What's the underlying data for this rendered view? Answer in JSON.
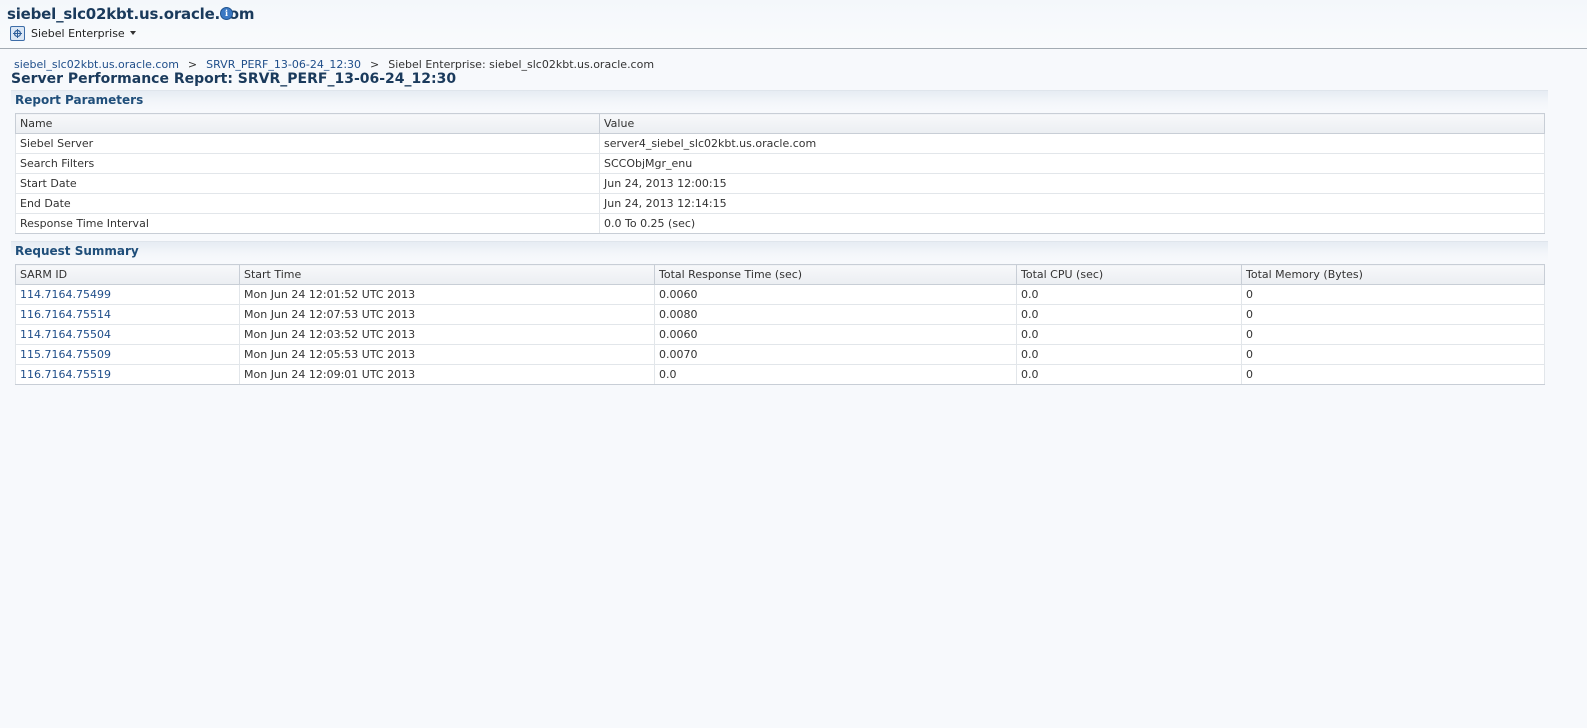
{
  "header": {
    "title": "siebel_slc02kbt.us.oracle.com",
    "target_menu_label": "Siebel Enterprise"
  },
  "breadcrumb": {
    "items": [
      "siebel_slc02kbt.us.oracle.com",
      "SRVR_PERF_13-06-24_12:30"
    ],
    "separator": ">",
    "current": "Siebel Enterprise: siebel_slc02kbt.us.oracle.com"
  },
  "page_title": "Server Performance Report: SRVR_PERF_13-06-24_12:30",
  "report_parameters": {
    "title": "Report Parameters",
    "columns": [
      "Name",
      "Value"
    ],
    "rows": [
      {
        "name": "Siebel Server",
        "value": "server4_siebel_slc02kbt.us.oracle.com"
      },
      {
        "name": "Search Filters",
        "value": "SCCObjMgr_enu"
      },
      {
        "name": "Start Date",
        "value": "Jun 24, 2013 12:00:15"
      },
      {
        "name": "End Date",
        "value": "Jun 24, 2013 12:14:15"
      },
      {
        "name": "Response Time Interval",
        "value": "0.0 To 0.25 (sec)"
      }
    ]
  },
  "request_summary": {
    "title": "Request Summary",
    "columns": [
      "SARM ID",
      "Start Time",
      "Total Response Time (sec)",
      "Total CPU (sec)",
      "Total Memory (Bytes)"
    ],
    "rows": [
      {
        "sarm_id": "114.7164.75499",
        "start_time": "Mon Jun 24 12:01:52 UTC 2013",
        "response": "0.0060",
        "cpu": "0.0",
        "memory": "0"
      },
      {
        "sarm_id": "116.7164.75514",
        "start_time": "Mon Jun 24 12:07:53 UTC 2013",
        "response": "0.0080",
        "cpu": "0.0",
        "memory": "0"
      },
      {
        "sarm_id": "114.7164.75504",
        "start_time": "Mon Jun 24 12:03:52 UTC 2013",
        "response": "0.0060",
        "cpu": "0.0",
        "memory": "0"
      },
      {
        "sarm_id": "115.7164.75509",
        "start_time": "Mon Jun 24 12:05:53 UTC 2013",
        "response": "0.0070",
        "cpu": "0.0",
        "memory": "0"
      },
      {
        "sarm_id": "116.7164.75519",
        "start_time": "Mon Jun 24 12:09:01 UTC 2013",
        "response": "0.0",
        "cpu": "0.0",
        "memory": "0"
      }
    ]
  },
  "icons": {
    "info": "info-icon",
    "target_menu": "target-icon",
    "dropdown": "chevron-down-icon"
  },
  "colors": {
    "title": "#1a3a5c",
    "link": "#1f4e8a",
    "section_title": "#1f4e7a"
  }
}
